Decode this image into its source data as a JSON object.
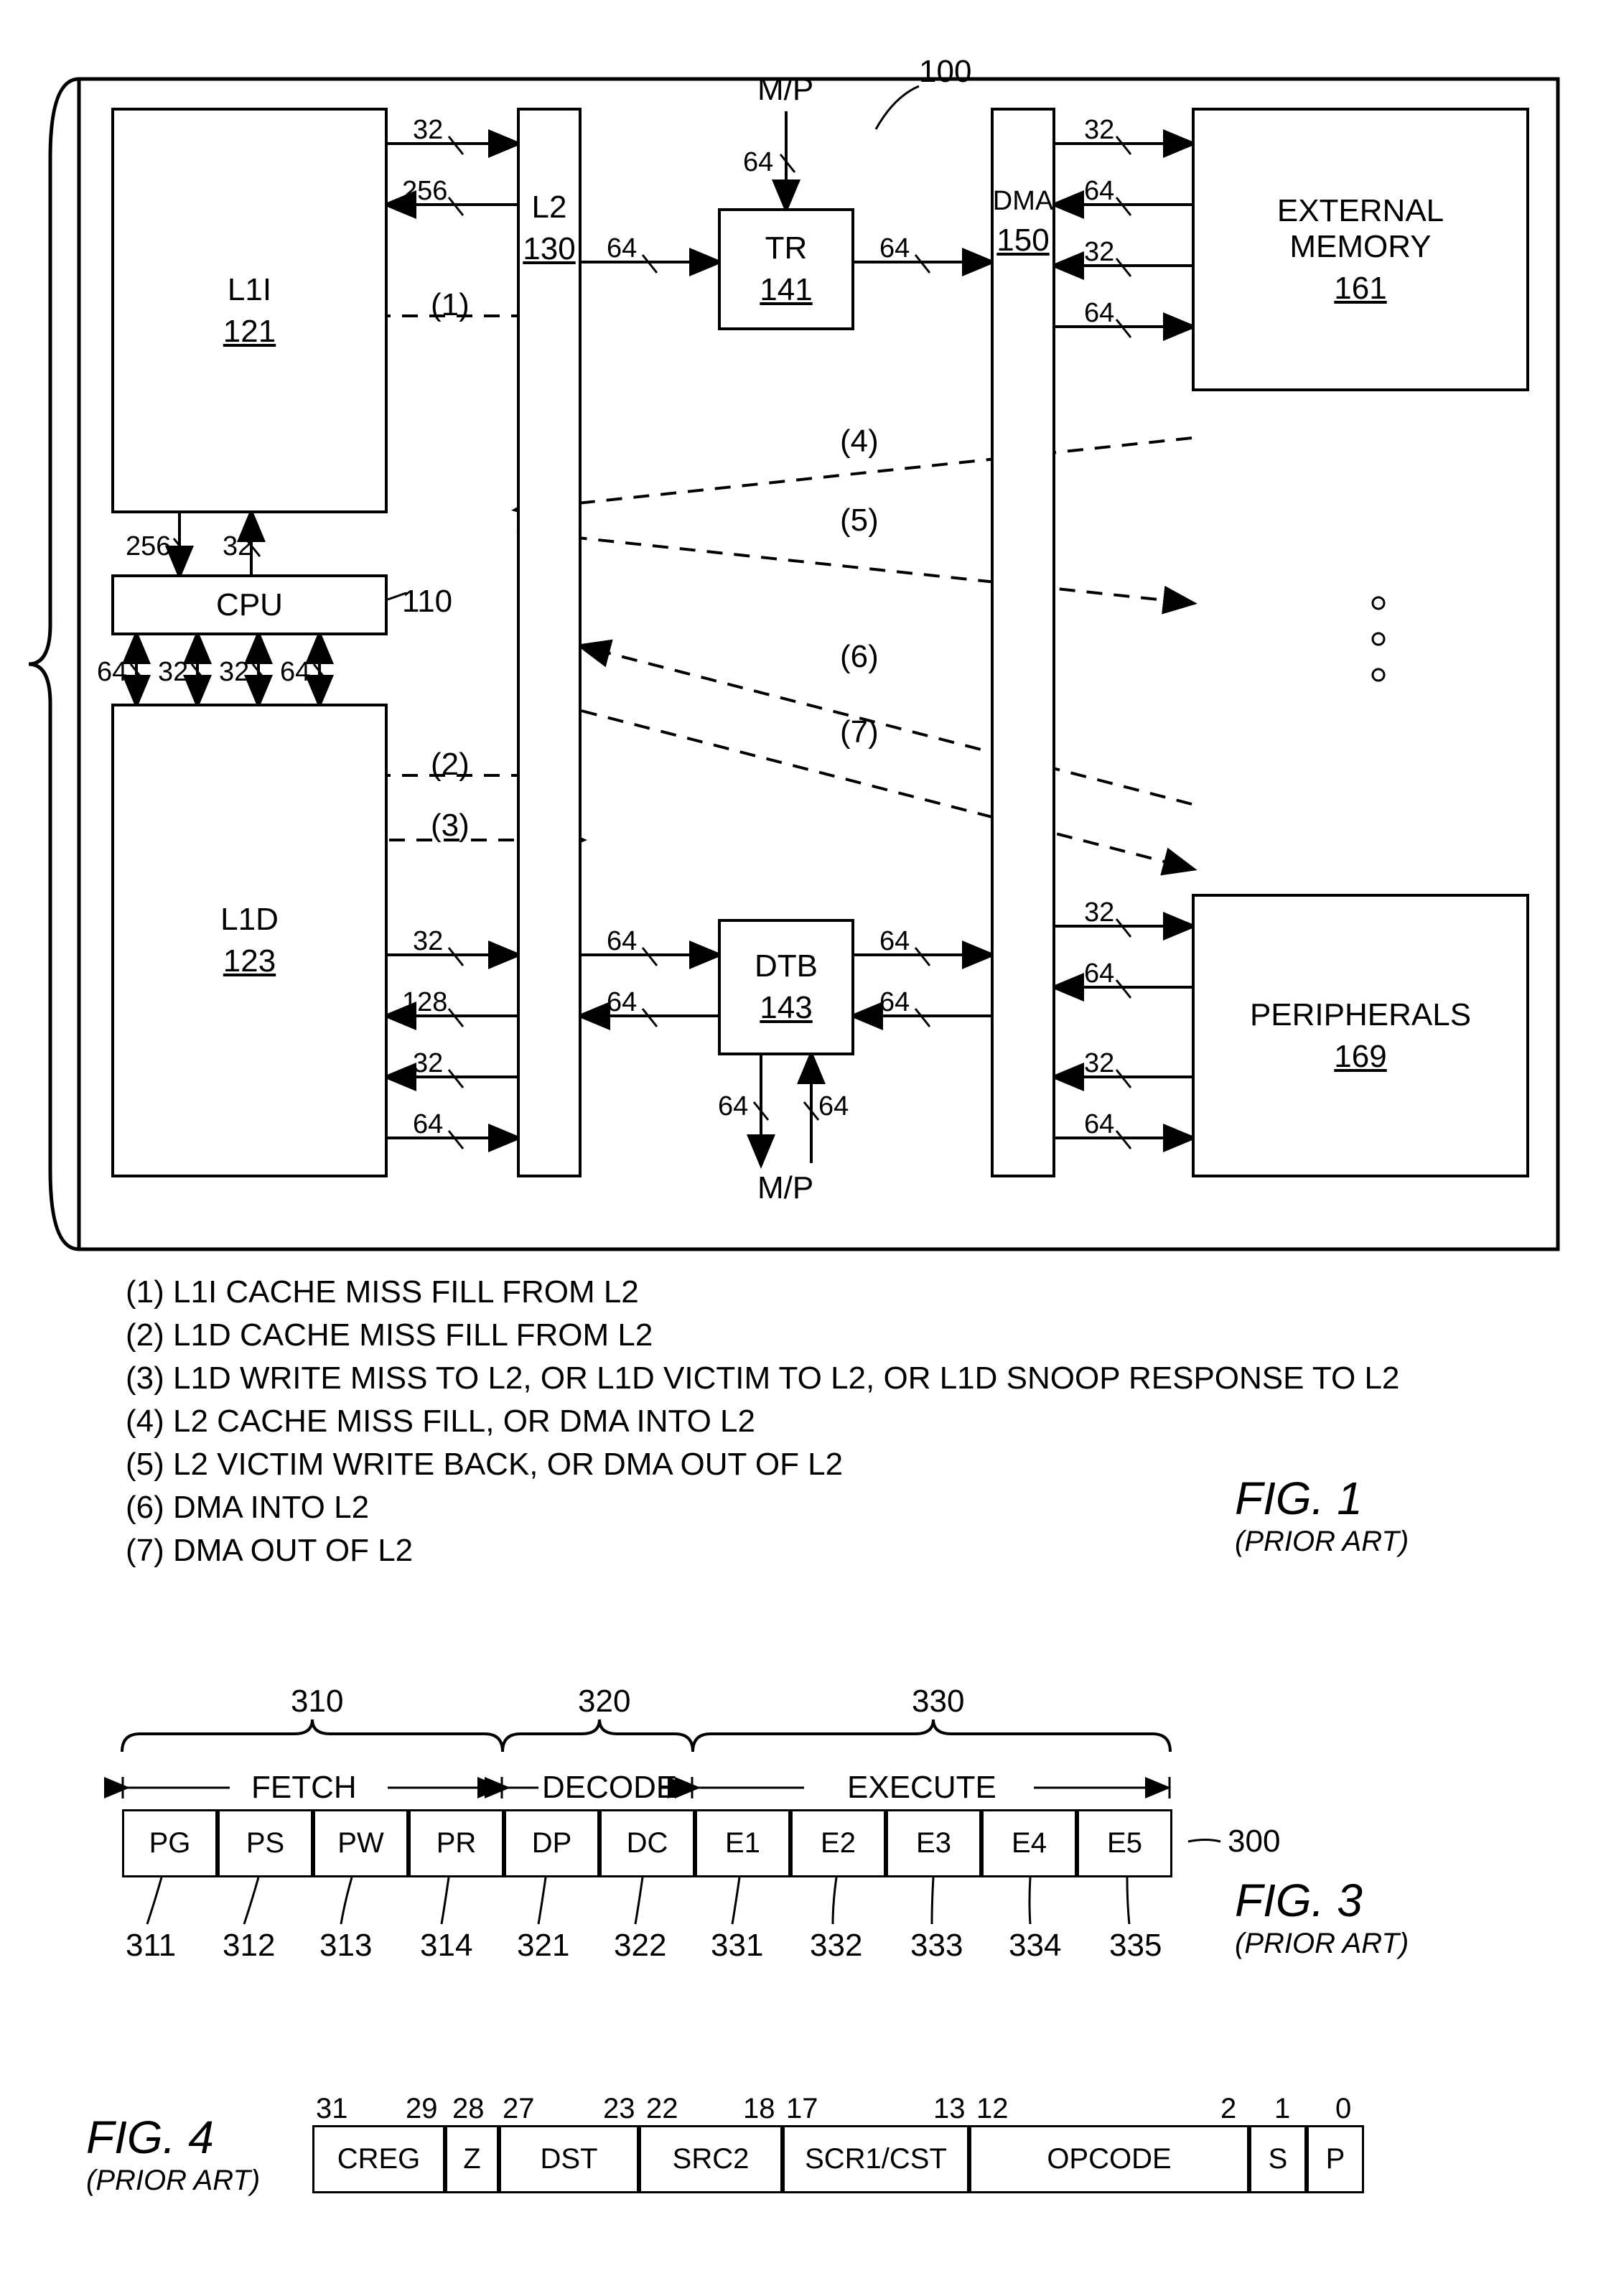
{
  "fig1": {
    "ref100": "100",
    "mp_top": "M/P",
    "mp_bot": "M/P",
    "blocks": {
      "l1i": {
        "label": "L1I",
        "ref": "121"
      },
      "l1d": {
        "label": "L1D",
        "ref": "123"
      },
      "cpu": {
        "label": "CPU",
        "ref": "110"
      },
      "l2": {
        "label": "L2",
        "ref": "130"
      },
      "tr": {
        "label": "TR",
        "ref": "141"
      },
      "dtb": {
        "label": "DTB",
        "ref": "143"
      },
      "dma": {
        "label": "DMA",
        "ref": "150"
      },
      "extmem": {
        "label": "EXTERNAL\nMEMORY",
        "ref": "161"
      },
      "periph": {
        "label": "PERIPHERALS",
        "ref": "169"
      }
    },
    "bus": {
      "l1i_l2_a": "32",
      "l1i_l2_b": "256",
      "l1i_cpu_a": "256",
      "l1i_cpu_b": "32",
      "cpu_l1d_1": "64",
      "cpu_l1d_2": "32",
      "cpu_l1d_3": "32",
      "cpu_l1d_4": "64",
      "l1d_l2_a": "32",
      "l1d_l2_b": "128",
      "l1d_l2_c": "32",
      "l1d_l2_d": "64",
      "l2_tr": "64",
      "tr_dma": "64",
      "tr_mp": "64",
      "l2_dtb_a": "64",
      "l2_dtb_b": "64",
      "dtb_dma_a": "64",
      "dtb_dma_b": "64",
      "dtb_mp_a": "64",
      "dtb_mp_b": "64",
      "dma_ext_a": "32",
      "dma_ext_b": "64",
      "dma_ext_c": "32",
      "dma_ext_d": "64",
      "dma_per_a": "32",
      "dma_per_b": "64",
      "dma_per_c": "32",
      "dma_per_d": "64"
    },
    "dash_labels": {
      "d1": "(1)",
      "d2": "(2)",
      "d3": "(3)",
      "d4": "(4)",
      "d5": "(5)",
      "d6": "(6)",
      "d7": "(7)"
    },
    "legend": {
      "l1": "(1) L1I CACHE MISS FILL FROM L2",
      "l2": "(2) L1D CACHE MISS FILL FROM L2",
      "l3": "(3) L1D WRITE MISS TO L2, OR L1D VICTIM TO L2, OR L1D SNOOP RESPONSE TO L2",
      "l4": "(4) L2 CACHE MISS FILL, OR DMA INTO L2",
      "l5": "(5) L2 VICTIM WRITE BACK, OR DMA OUT OF L2",
      "l6": "(6) DMA INTO L2",
      "l7": "(7) DMA OUT OF L2"
    },
    "title": "FIG. 1",
    "subtitle": "(PRIOR ART)",
    "ellipsis": "⋮"
  },
  "fig3": {
    "group_refs": {
      "fetch": "310",
      "decode": "320",
      "execute": "330"
    },
    "phases": {
      "fetch": "FETCH",
      "decode": "DECODE",
      "execute": "EXECUTE"
    },
    "ref300": "300",
    "stages": {
      "s311": "PG",
      "s312": "PS",
      "s313": "PW",
      "s314": "PR",
      "s321": "DP",
      "s322": "DC",
      "s331": "E1",
      "s332": "E2",
      "s333": "E3",
      "s334": "E4",
      "s335": "E5"
    },
    "stage_refs": {
      "r311": "311",
      "r312": "312",
      "r313": "313",
      "r314": "314",
      "r321": "321",
      "r322": "322",
      "r331": "331",
      "r332": "332",
      "r333": "333",
      "r334": "334",
      "r335": "335"
    },
    "title": "FIG. 3",
    "subtitle": "(PRIOR ART)"
  },
  "fig4": {
    "bits": {
      "b31": "31",
      "b29": "29",
      "b28": "28",
      "b27": "27",
      "b23": "23",
      "b22": "22",
      "b18": "18",
      "b17": "17",
      "b13": "13",
      "b12": "12",
      "b2": "2",
      "b1": "1",
      "b0": "0"
    },
    "fields": {
      "creg": "CREG",
      "z": "Z",
      "dst": "DST",
      "src2": "SRC2",
      "src1": "SCR1/CST",
      "opcode": "OPCODE",
      "s": "S",
      "p": "P"
    },
    "title": "FIG. 4",
    "subtitle": "(PRIOR ART)"
  }
}
